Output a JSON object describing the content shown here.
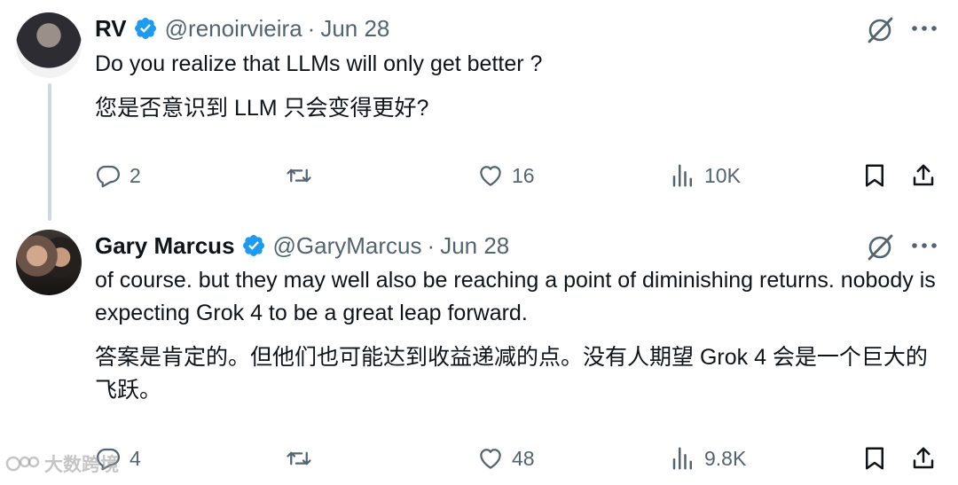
{
  "tweets": [
    {
      "name": "RV",
      "handle": "@renoirvieira",
      "separator": "·",
      "date": "Jun 28",
      "text_en": "Do you realize that LLMs will only get better ?",
      "text_zh": "您是否意识到 LLM 只会变得更好?",
      "replies": "2",
      "retweets": "",
      "likes": "16",
      "views": "10K"
    },
    {
      "name": "Gary Marcus",
      "handle": "@GaryMarcus",
      "separator": "·",
      "date": "Jun 28",
      "text_en": "of course. but they may well also be reaching a point of diminishing returns. nobody is expecting Grok 4 to be a great leap forward.",
      "text_zh": "答案是肯定的。但他们也可能达到收益递减的点。没有人期望 Grok 4 会是一个巨大的飞跃。",
      "replies": "4",
      "retweets": "",
      "likes": "48",
      "views": "9.8K"
    }
  ],
  "watermark": "大数跨境",
  "icons": {
    "verified": "verified-badge-icon",
    "grok": "grok-icon",
    "more": "more-icon",
    "reply": "reply-icon",
    "retweet": "retweet-icon",
    "like": "heart-icon",
    "views": "views-icon",
    "bookmark": "bookmark-icon",
    "share": "share-icon"
  },
  "colors": {
    "text": "#0f1419",
    "secondary": "#536471",
    "verified": "#1d9bf0",
    "thread_line": "#cfd9de"
  }
}
